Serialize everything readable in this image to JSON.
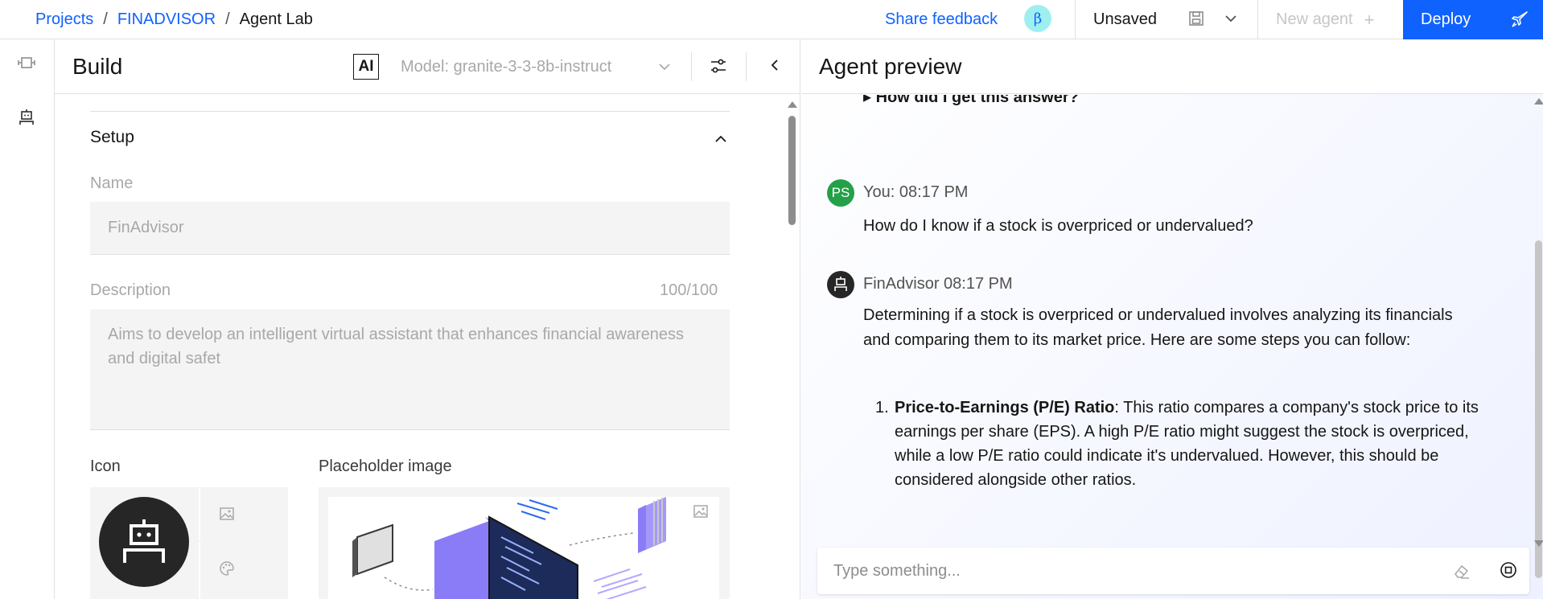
{
  "breadcrumb": {
    "projects": "Projects",
    "project": "FINADVISOR",
    "current": "Agent Lab",
    "separator": "/"
  },
  "topbar": {
    "share_feedback": "Share feedback",
    "beta_badge": "β",
    "save_status": "Unsaved",
    "new_agent": "New agent",
    "new_agent_plus": "+",
    "deploy": "Deploy"
  },
  "build": {
    "title": "Build",
    "ai_badge": "AI",
    "model": "Model: granite-3-3-8b-instruct",
    "setup": {
      "title": "Setup",
      "name_label": "Name",
      "name_value": "FinAdvisor",
      "description_label": "Description",
      "description_counter": "100/100",
      "description_value": "Aims to develop an intelligent virtual assistant that enhances financial awareness and digital safet",
      "icon_label": "Icon",
      "placeholder_image_label": "Placeholder image"
    }
  },
  "preview": {
    "title": "Agent preview",
    "how_answer": "▸ How did I get this answer?",
    "user_avatar": "PS",
    "user_meta": "You: 08:17 PM",
    "user_message": "How do I know if a stock is overpriced or undervalued?",
    "agent_meta": "FinAdvisor 08:17 PM",
    "agent_intro": "Determining if a stock is overpriced or undervalued involves analyzing its financials and comparing them to its market price. Here are some steps you can follow:",
    "list_num": "1.",
    "list_bold": "Price-to-Earnings (P/E) Ratio",
    "list_text": ": This ratio compares a company's stock price to its earnings per share (EPS). A high P/E ratio might suggest the stock is overpriced, while a low P/E ratio could indicate it's undervalued. However, this should be considered alongside other ratios.",
    "composer_placeholder": "Type something..."
  },
  "colors": {
    "accent": "#0f62fe",
    "user_avatar": "#24a148",
    "beta_badge": "#9ef0f0"
  },
  "icons": [
    "save-icon",
    "chevron-down-icon",
    "rocket-icon",
    "flow-icon",
    "robot-icon",
    "settings-adjust-icon",
    "chevron-left-icon",
    "chevron-up-icon",
    "image-icon",
    "palette-icon",
    "eraser-icon",
    "stop-icon"
  ]
}
